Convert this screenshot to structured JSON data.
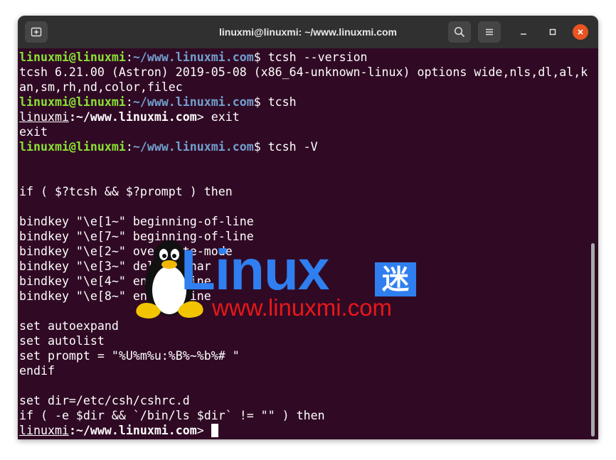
{
  "window": {
    "title": "linuxmi@linuxmi: ~/www.linuxmi.com",
    "buttons": {
      "new_tab_icon": "new-tab-icon",
      "search_icon": "search-icon",
      "menu_icon": "hamburger-menu-icon",
      "minimize_icon": "minimize-icon",
      "maximize_icon": "maximize-icon",
      "close_icon": "close-icon"
    },
    "accent_close": "#e95420"
  },
  "terminal": {
    "background": "#300a24",
    "prompt": {
      "user_host": "linuxmi@linuxmi",
      "colon": ":",
      "path": "~/www.linuxmi.com",
      "dollar": "$ "
    },
    "tcsh_prompt": {
      "user": "linuxmi",
      "rest": ":~/www.linuxmi.com",
      "gt": "> "
    },
    "commands": {
      "c1": "tcsh --version",
      "c2": "tcsh",
      "c3": "exit",
      "c4": "tcsh -V"
    },
    "output": {
      "version_1": "tcsh 6.21.00 (Astron) 2019-05-08 (x86_64-unknown-linux) options wide,nls,dl,al,k",
      "version_2": "an,sm,rh,nd,color,filec",
      "exit_echo": "exit",
      "blank": "",
      "if_line": "if ( $?tcsh && $?prompt ) then",
      "bk1": "bindkey \"\\e[1~\" beginning-of-line",
      "bk2": "bindkey \"\\e[7~\" beginning-of-line",
      "bk3": "bindkey \"\\e[2~\" overwrite-mode",
      "bk4": "bindkey \"\\e[3~\" delete-char",
      "bk5": "bindkey \"\\e[4~\" end-of-line",
      "bk6": "bindkey \"\\e[8~\" end-of-line",
      "set1": "set autoexpand",
      "set2": "set autolist",
      "set3": "set prompt = \"%U%m%u:%B%~%b%# \"",
      "endif": "endif",
      "dir": "set dir=/etc/csh/cshrc.d",
      "if2": "if ( -e $dir && `/bin/ls $dir` != \"\" ) then"
    }
  },
  "watermark": {
    "brand": "Linux",
    "mi_char": "迷",
    "url": "www.linuxmi.com",
    "brand_color": "#2f7ff0",
    "url_color": "#e8171a"
  }
}
